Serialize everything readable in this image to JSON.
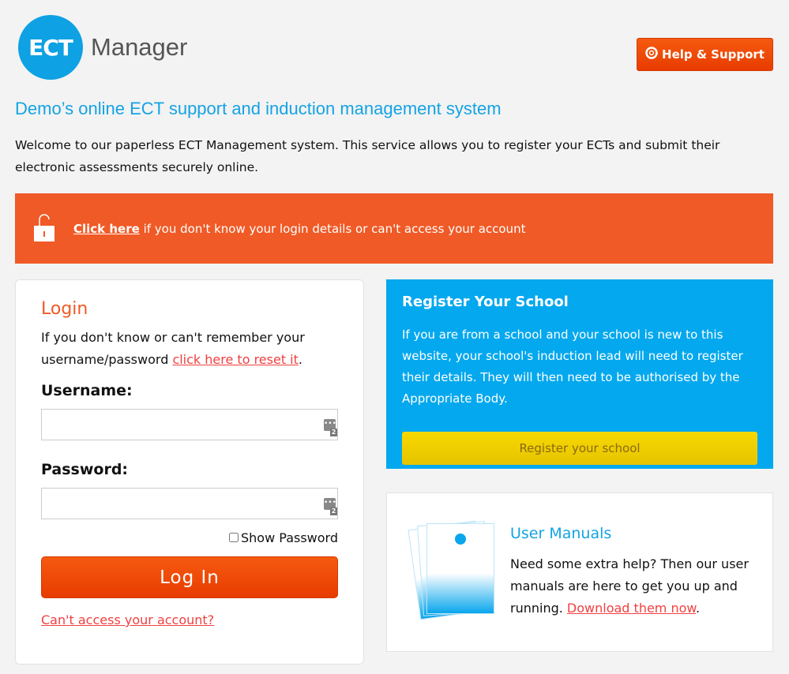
{
  "header": {
    "logo_mark": "ECT",
    "logo_text": "Manager",
    "help_label": "Help & Support"
  },
  "title": "Demo’s online ECT support and induction management system",
  "intro": "Welcome to our paperless ECT Management system. This service allows you to register your ECTs and submit their electronic assessments securely online.",
  "alert": {
    "link": "Click here",
    "text": " if you don't know your login details or can't access your account"
  },
  "login": {
    "title": "Login",
    "help_text": "If you don't know or can't remember your username/password ",
    "reset_link": "click here to reset it",
    "reset_suffix": ".",
    "username_label": "Username:",
    "username_value": "",
    "password_label": "Password:",
    "password_value": "",
    "manager_badge": "2",
    "show_password": "Show Password",
    "login_button": "Log In",
    "cant_access": "Can't access your account?"
  },
  "register": {
    "title": "Register Your School",
    "text": "If you are from a school and your school is new to this website, your school's induction lead will need to register their details. They will then need to be authorised by the Appropriate Body.",
    "button": "Register your school"
  },
  "manuals": {
    "title": "User Manuals",
    "text": "Need some extra help? Then our user manuals are here to get you up and running. ",
    "link": "Download them now",
    "suffix": "."
  },
  "colors": {
    "brand_blue": "#0ea1e3",
    "accent_orange": "#f05a26",
    "button_yellow": "#f0d000"
  }
}
